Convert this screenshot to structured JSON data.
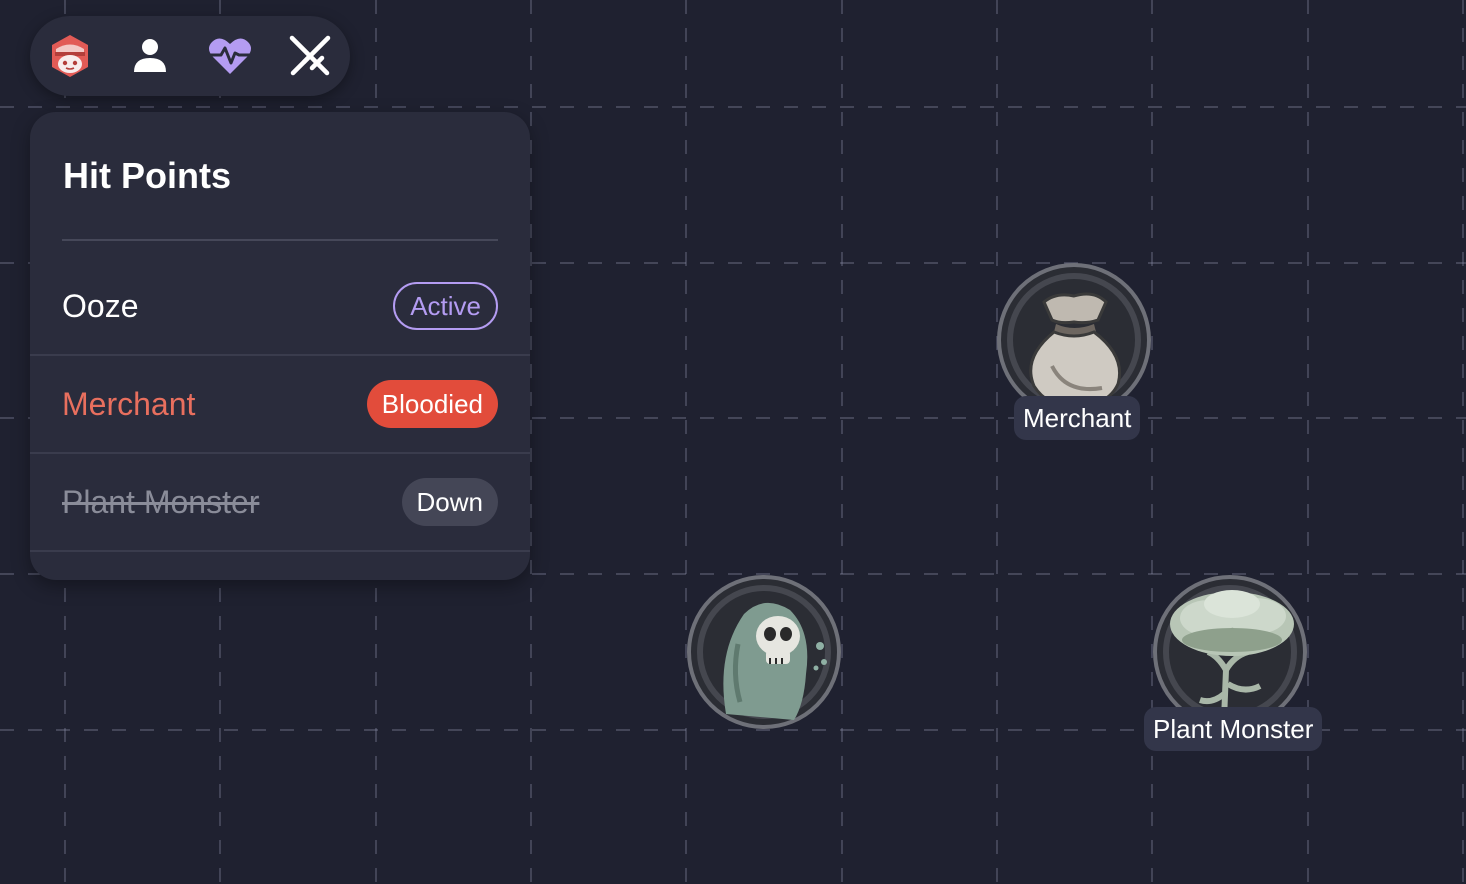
{
  "toolbar": {
    "tools": [
      {
        "name": "red-mascot-icon"
      },
      {
        "name": "person-icon"
      },
      {
        "name": "heart-pulse-icon"
      },
      {
        "name": "crossed-swords-icon"
      }
    ]
  },
  "panel": {
    "title": "Hit Points",
    "rows": [
      {
        "name": "Ooze",
        "status": "Active",
        "name_color": "#ffffff",
        "badge_style": "outline",
        "badge_color": "#b49cf2"
      },
      {
        "name": "Merchant",
        "status": "Bloodied",
        "name_color": "#e86f5e",
        "badge_style": "filled",
        "badge_color": "#e24c3b"
      },
      {
        "name": "Plant Monster",
        "status": "Down",
        "name_color": "#8a8c99",
        "badge_style": "muted",
        "badge_color": "#444656",
        "strikethrough": true
      }
    ]
  },
  "map": {
    "tokens": [
      {
        "label": "Merchant",
        "icon": "money-bag-icon"
      },
      {
        "label": "",
        "icon": "ghost-skull-icon"
      },
      {
        "label": "Plant Monster",
        "icon": "tree-icon"
      }
    ]
  },
  "colors": {
    "background": "#1f2130",
    "panel": "#2a2c3c",
    "grid_line": "#8a8ea8",
    "accent_purple": "#b49cf2",
    "bloodied_red": "#e24c3b"
  }
}
